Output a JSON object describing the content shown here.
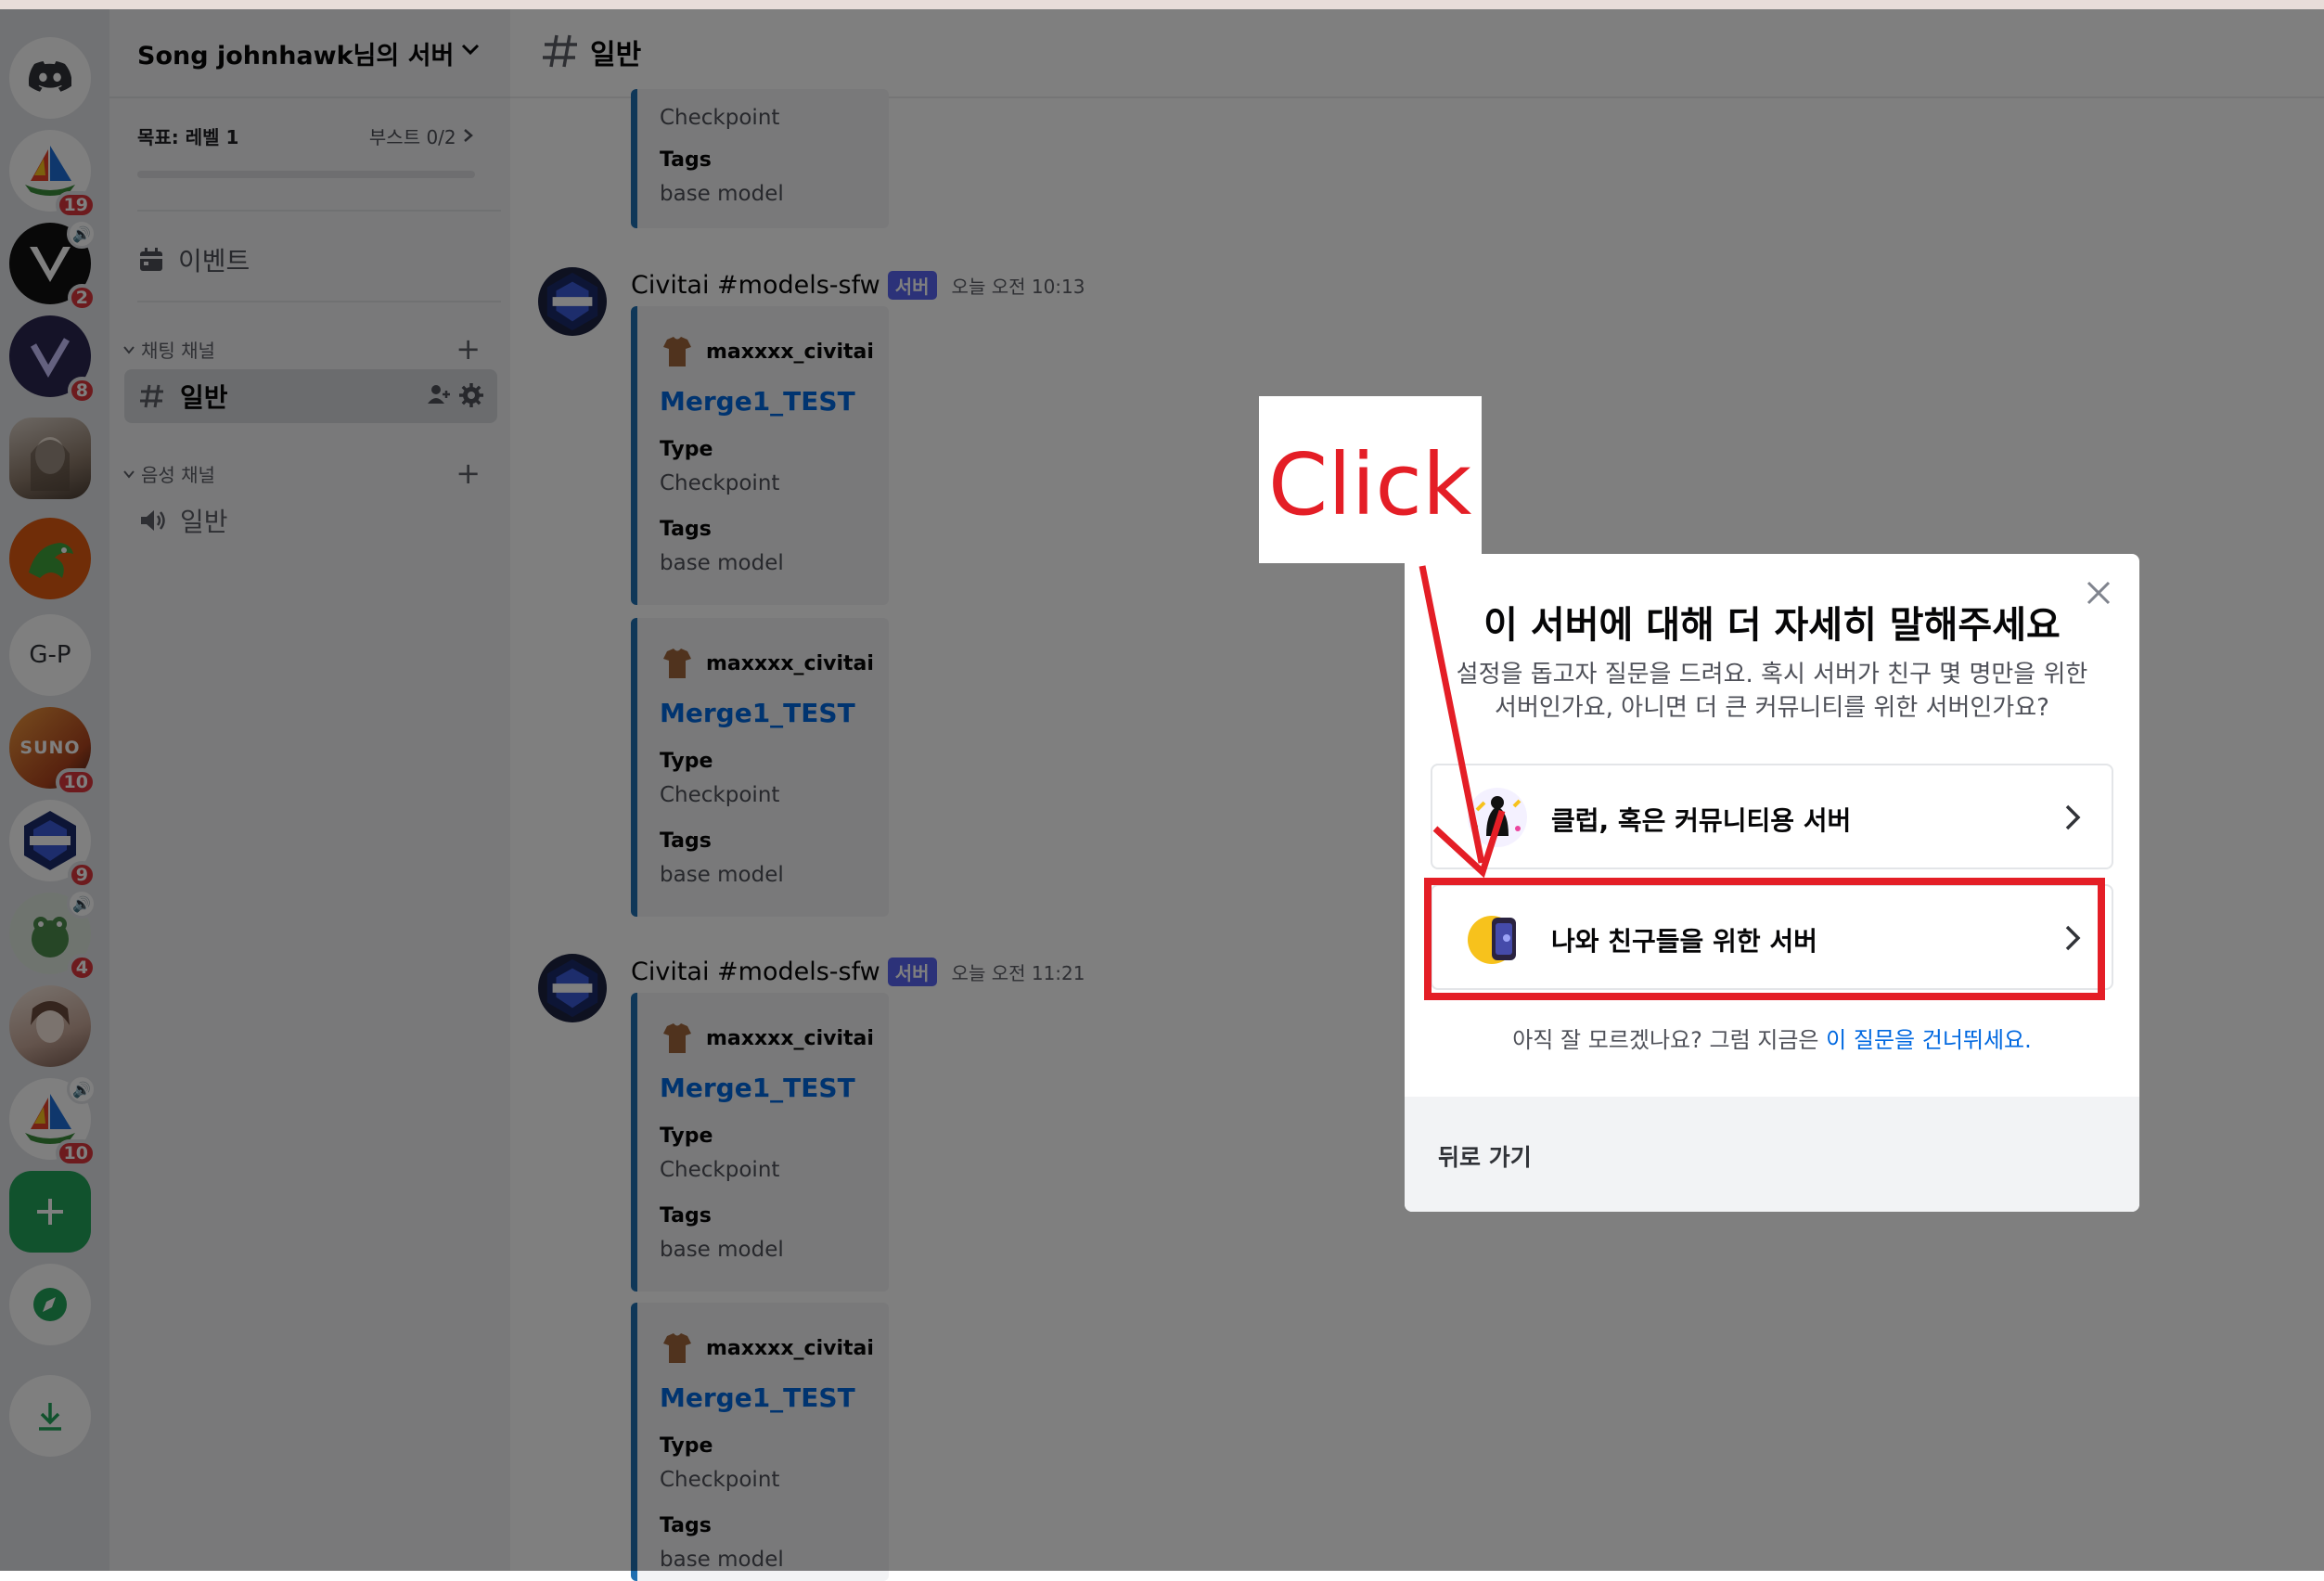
{
  "server": {
    "name": "Song johnhawk님의 서버",
    "goal_label": "목표: 레벨 1",
    "boost_label": "부스트 0/2",
    "events_label": "이벤트",
    "text_category": "채팅 채널",
    "voice_category": "음성 채널",
    "text_channel": "일반",
    "voice_channel": "일반"
  },
  "rail": {
    "badges": [
      "19",
      "2",
      "8",
      "10",
      "9",
      "4",
      "10"
    ],
    "gp_label": "G-P",
    "suno_label": "SUNO"
  },
  "main": {
    "channel_title": "일반",
    "messages": [
      {
        "author": "Civitai #models-sfw",
        "tag": "서버",
        "time": "오늘 오전 10:13"
      },
      {
        "author": "Civitai #models-sfw",
        "tag": "서버",
        "time": "오늘 오전 11:21"
      }
    ],
    "embed": {
      "author": "maxxxx_civitai",
      "title": "Merge1_TEST",
      "field1_name": "Type",
      "field1_value": "Checkpoint",
      "field2_name": "Tags",
      "field2_value": "base model"
    }
  },
  "modal": {
    "title": "이 서버에 대해 더 자세히 말해주세요",
    "subtitle": "설정을 돕고자 질문을 드려요. 혹시 서버가 친구 몇 명만을 위한 서버인가요, 아니면 더 큰 커뮤니티를 위한 서버인가요?",
    "option1": "클럽, 혹은 커뮤니티용 서버",
    "option2": "나와 친구들을 위한 서버",
    "skip_prefix": "아직 잘 모르겠나요? 그럼 지금은 ",
    "skip_link": "이 질문을 건너뛰세요.",
    "back": "뒤로 가기"
  },
  "annotation": {
    "callout": "Click",
    "color": "#e41e26"
  },
  "colors": {
    "rail_bg": "#e3e5e8",
    "sidebar_bg": "#f2f3f5",
    "brand": "#5865f2",
    "link": "#0068e0",
    "badge": "#da373c",
    "green": "#23a55a"
  }
}
